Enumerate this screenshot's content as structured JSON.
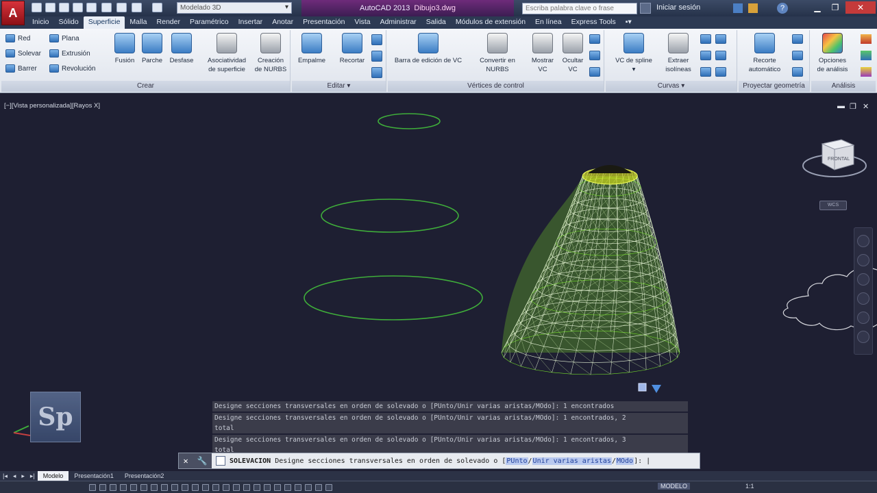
{
  "app": {
    "title_app": "AutoCAD 2013",
    "title_file": "Dibujo3.dwg",
    "workspace": "Modelado 3D",
    "search_placeholder": "Escriba palabra clave o frase",
    "login": "Iniciar sesión",
    "app_button_icon": "autocad-a-icon"
  },
  "ribbon": {
    "tabs": [
      "Inicio",
      "Sólido",
      "Superficie",
      "Malla",
      "Render",
      "Paramétrico",
      "Insertar",
      "Anotar",
      "Presentación",
      "Vista",
      "Administrar",
      "Salida",
      "Módulos de extensión",
      "En línea",
      "Express Tools"
    ],
    "active_tab": "Superficie",
    "panels": {
      "crear": {
        "title": "Crear",
        "small_left": [
          "Red",
          "Solevar",
          "Barrer"
        ],
        "small_right": [
          "Plana",
          "Extrusión",
          "Revolución"
        ],
        "large": [
          {
            "l1": "Fusión",
            "l2": ""
          },
          {
            "l1": "Parche",
            "l2": ""
          },
          {
            "l1": "Desfase",
            "l2": ""
          },
          {
            "l1": "Asociatividad",
            "l2": "de superficie"
          },
          {
            "l1": "Creación",
            "l2": "de NURBS"
          }
        ]
      },
      "editar": {
        "title": "Editar ▾",
        "large": [
          {
            "l1": "Empalme",
            "l2": ""
          },
          {
            "l1": "Recortar",
            "l2": ""
          }
        ]
      },
      "vertices": {
        "title": "Vértices de control",
        "large": [
          {
            "l1": "Barra de edición de VC",
            "l2": ""
          },
          {
            "l1": "Convertir en",
            "l2": "NURBS"
          },
          {
            "l1": "Mostrar",
            "l2": "VC"
          },
          {
            "l1": "Ocultar",
            "l2": "VC"
          }
        ]
      },
      "curvas": {
        "title": "Curvas ▾",
        "large": [
          {
            "l1": "VC de spline",
            "l2": "▾"
          },
          {
            "l1": "Extraer",
            "l2": "isolíneas"
          }
        ]
      },
      "proyectar": {
        "title": "Proyectar geometría",
        "large": [
          {
            "l1": "Recorte",
            "l2": "automático"
          }
        ]
      },
      "analisis": {
        "title": "Análisis",
        "large": [
          {
            "l1": "Opciones",
            "l2": "de análisis"
          }
        ]
      }
    }
  },
  "viewport": {
    "label": "[−][Vista personalizada][Rayos X]",
    "viewcube_face": "FRONTAL",
    "wcs_label": "WCS",
    "logo_text": "Sp"
  },
  "command": {
    "history": [
      "Designe secciones transversales en orden de solevado o [PUnto/Unir varias aristas/MOdo]: 1 encontrados",
      "Designe secciones transversales en orden de solevado o [PUnto/Unir varias aristas/MOdo]: 1 encontrados, 2",
      "total",
      "Designe secciones transversales en orden de solevado o [PUnto/Unir varias aristas/MOdo]: 1 encontrados, 3",
      "total"
    ],
    "current_cmd": "SOLEVACION",
    "prompt": "Designe secciones transversales en orden de solevado o [",
    "opt1": "PUnto",
    "opt2": "Unir varias aristas",
    "opt3": "MOdo",
    "prompt_end": "]: |"
  },
  "layout_tabs": [
    "Modelo",
    "Presentación1",
    "Presentación2"
  ],
  "status": {
    "mode": "MODELO",
    "scale": "1:1"
  }
}
